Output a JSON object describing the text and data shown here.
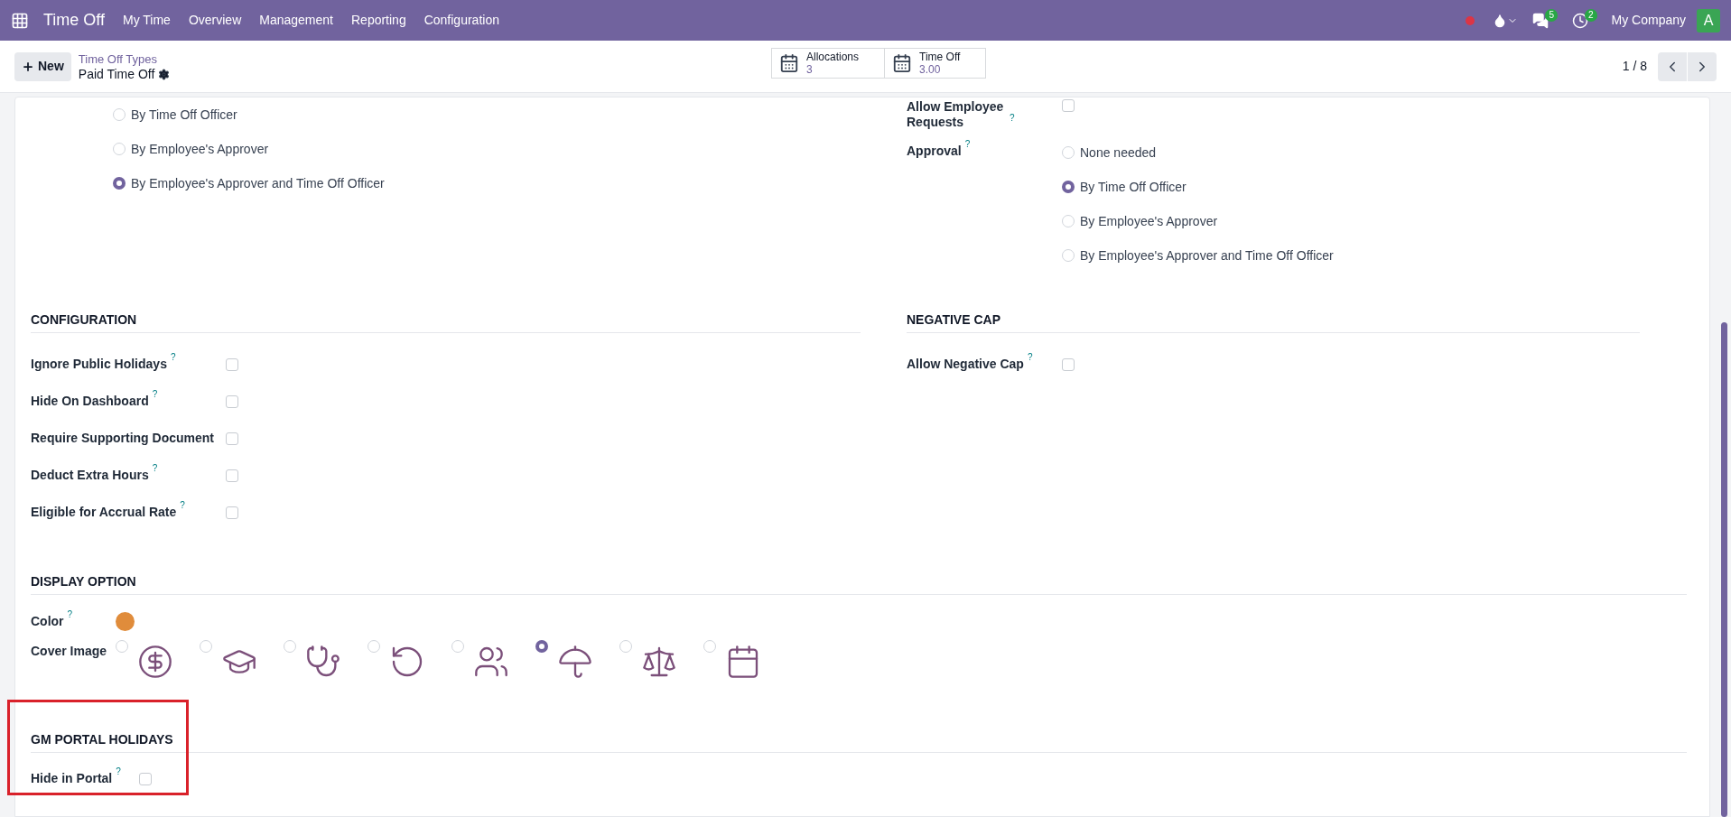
{
  "navbar": {
    "app_title": "Time Off",
    "menu": [
      "My Time",
      "Overview",
      "Management",
      "Reporting",
      "Configuration"
    ],
    "chat_count": "5",
    "activity_count": "2",
    "company": "My Company",
    "avatar": "A"
  },
  "control_panel": {
    "new_button": "New",
    "breadcrumb": "Time Off Types",
    "record": "Paid Time Off",
    "smart_buttons": [
      {
        "label": "Allocations",
        "value": "3"
      },
      {
        "label": "Time Off",
        "value": "3.00"
      }
    ],
    "pager": "1 / 8"
  },
  "top_left": {
    "options": [
      {
        "label": "By Time Off Officer",
        "selected": false
      },
      {
        "label": "By Employee's Approver",
        "selected": false
      },
      {
        "label": "By Employee's Approver and Time Off Officer",
        "selected": true
      }
    ]
  },
  "top_right": {
    "allow_requests": {
      "label": "Allow Employee Requests",
      "help": "?",
      "checked": false
    },
    "approval": {
      "label": "Approval",
      "help": "?",
      "options": [
        {
          "label": "None needed",
          "selected": false
        },
        {
          "label": "By Time Off Officer",
          "selected": true
        },
        {
          "label": "By Employee's Approver",
          "selected": false
        },
        {
          "label": "By Employee's Approver and Time Off Officer",
          "selected": false
        }
      ]
    }
  },
  "configuration": {
    "title": "CONFIGURATION",
    "fields": [
      {
        "label": "Ignore Public Holidays",
        "help": "?",
        "checked": false
      },
      {
        "label": "Hide On Dashboard",
        "help": "?",
        "checked": false
      },
      {
        "label": "Require Supporting Document",
        "checked": false
      },
      {
        "label": "Deduct Extra Hours",
        "help": "?",
        "checked": false
      },
      {
        "label": "Eligible for Accrual Rate",
        "help": "?",
        "checked": false
      }
    ]
  },
  "negative_cap": {
    "title": "NEGATIVE CAP",
    "fields": [
      {
        "label": "Allow Negative Cap",
        "help": "?",
        "checked": false
      }
    ]
  },
  "display_option": {
    "title": "DISPLAY OPTION",
    "color": {
      "label": "Color",
      "help": "?",
      "color": "#e08c3b"
    },
    "cover_image": {
      "label": "Cover Image",
      "images": [
        {
          "selected": false
        },
        {
          "selected": false
        },
        {
          "selected": false
        },
        {
          "selected": false
        },
        {
          "selected": false
        },
        {
          "selected": true
        },
        {
          "selected": false
        },
        {
          "selected": false
        }
      ]
    }
  },
  "gm_portal": {
    "title": "GM PORTAL HOLIDAYS",
    "fields": [
      {
        "label": "Hide in Portal",
        "help": "?",
        "checked": false
      }
    ]
  }
}
